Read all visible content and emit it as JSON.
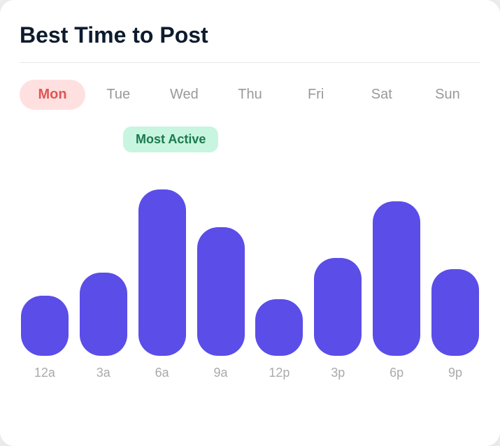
{
  "card": {
    "title": "Best Time to Post"
  },
  "days": [
    {
      "label": "Mon",
      "active": true
    },
    {
      "label": "Tue",
      "active": false
    },
    {
      "label": "Wed",
      "active": false
    },
    {
      "label": "Thu",
      "active": false
    },
    {
      "label": "Fri",
      "active": false
    },
    {
      "label": "Sat",
      "active": false
    },
    {
      "label": "Sun",
      "active": false
    }
  ],
  "mostActiveBadge": "Most Active",
  "bars": [
    {
      "label": "12a",
      "heightPct": 32
    },
    {
      "label": "3a",
      "heightPct": 44
    },
    {
      "label": "6a",
      "heightPct": 88
    },
    {
      "label": "9a",
      "heightPct": 68
    },
    {
      "label": "12p",
      "heightPct": 30
    },
    {
      "label": "3p",
      "heightPct": 52
    },
    {
      "label": "6p",
      "heightPct": 82
    },
    {
      "label": "9p",
      "heightPct": 46
    }
  ],
  "colors": {
    "bar": "#5b4de8",
    "activeDay": "#ffe0e0",
    "activeDayText": "#e05555",
    "badge": "#c8f5e0",
    "badgeText": "#1a7a4e",
    "title": "#0d1b2e"
  }
}
